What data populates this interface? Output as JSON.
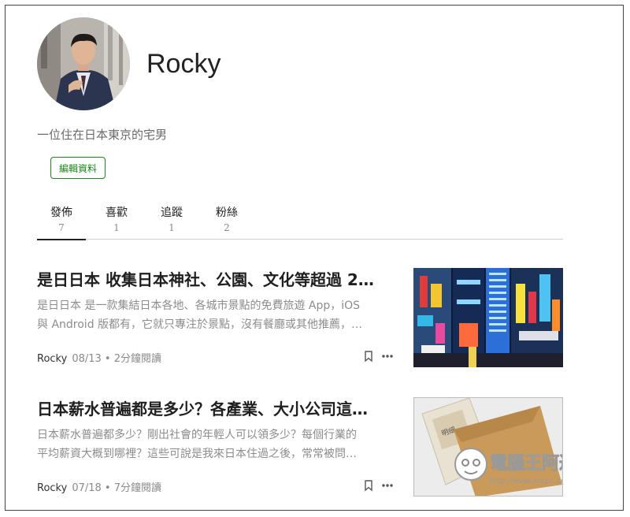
{
  "profile": {
    "name": "Rocky",
    "bio": "一位住在日本東京的宅男",
    "edit_label": "編輯資料"
  },
  "tabs": [
    {
      "label": "發佈",
      "count": "7"
    },
    {
      "label": "喜歡",
      "count": "1"
    },
    {
      "label": "追蹤",
      "count": "1"
    },
    {
      "label": "粉絲",
      "count": "2"
    }
  ],
  "posts": [
    {
      "title": "是日日本 收集日本神社、公園、文化等超過 2…",
      "excerpt_lines": [
        "是日日本 是一款集結日本各地、各城市景點的免費旅遊 App，iOS",
        "與 Android 版都有，它就只專注於景點，沒有餐廳或其他推薦，…"
      ],
      "author": "Rocky",
      "meta": "08/13 • 2分鐘閱讀"
    },
    {
      "title": "日本薪水普遍都是多少？各產業、大小公司這…",
      "excerpt_lines": [
        "日本薪水普遍都多少？剛出社會的年輕人可以領多少？每個行業的",
        "平均薪資大概到哪裡？這些可說是我來日本住過之後，常常被問…"
      ],
      "author": "Rocky",
      "meta": "07/18 • 7分鐘閱讀"
    }
  ],
  "watermark": {
    "brand": "電腦王阿達",
    "url": "http://www.kocpc.com.tw"
  },
  "icons": {
    "bookmark": "bookmark-icon",
    "more": "more-options-icon"
  },
  "colors": {
    "accent": "#1a8917",
    "text": "#222222",
    "muted": "#8c8c8c"
  }
}
